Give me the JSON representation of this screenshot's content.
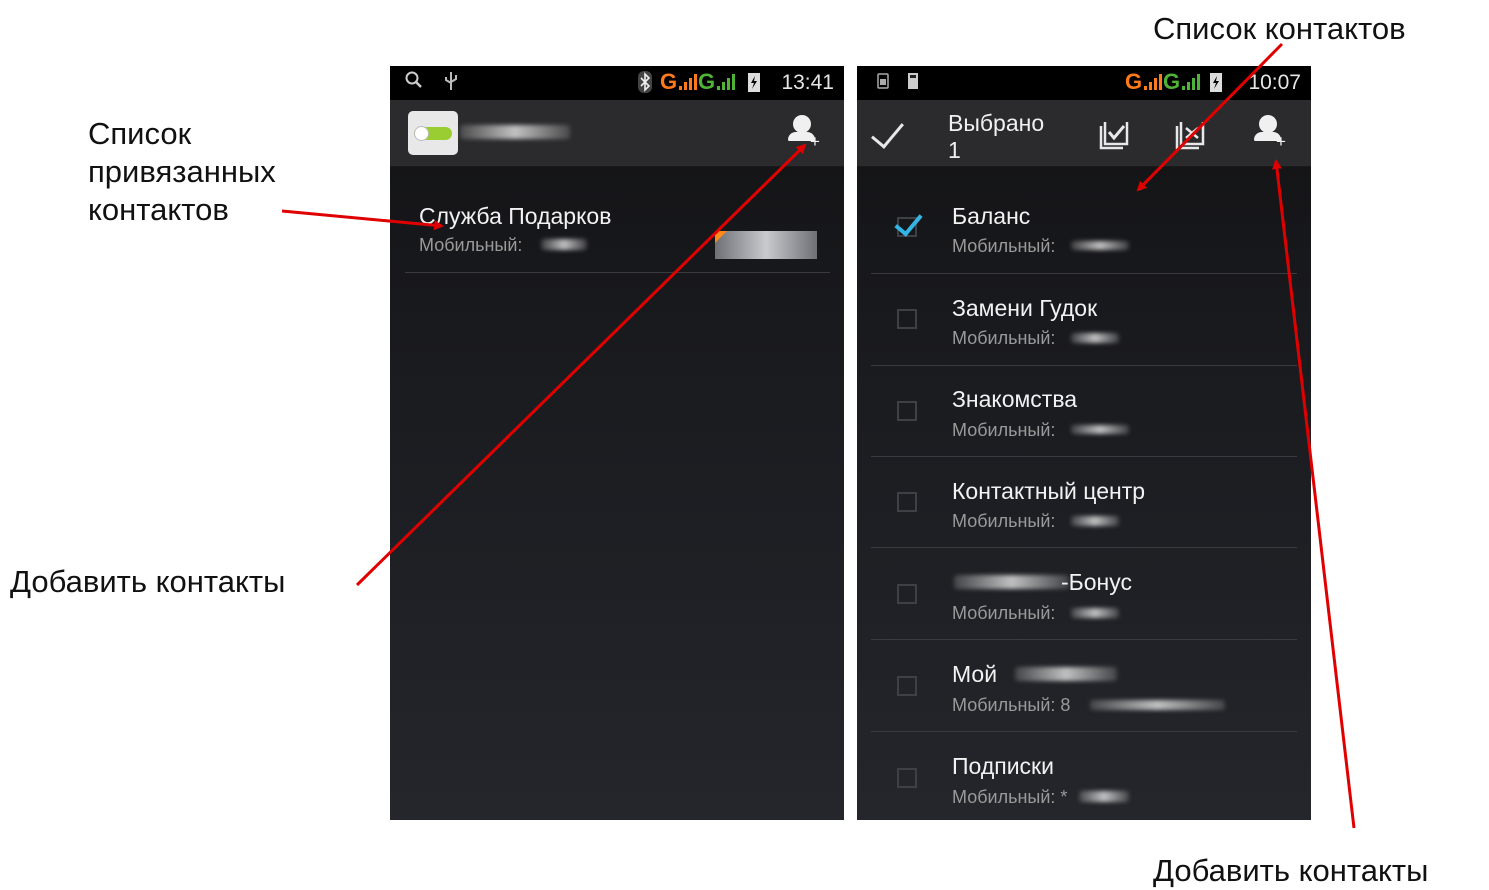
{
  "annotations": {
    "top_right": "Список контактов",
    "left_top": [
      "Список",
      "привязанных",
      "контактов"
    ],
    "left_bottom": "Добавить контакты",
    "bottom_right": "Добавить контакты"
  },
  "left_screen": {
    "status": {
      "time": "13:41",
      "network1": "G",
      "network2": "G"
    },
    "contacts": [
      {
        "name": "Служба Подарков",
        "subtitle": "Мобильный:"
      }
    ]
  },
  "right_screen": {
    "status": {
      "time": "10:07",
      "network1": "G",
      "network2": "G"
    },
    "selection": {
      "label": "Выбрано",
      "count": "1"
    },
    "contacts": [
      {
        "name": "Баланс",
        "subtitle": "Мобильный:",
        "checked": true
      },
      {
        "name": "Замени Гудок",
        "subtitle": "Мобильный:",
        "checked": false
      },
      {
        "name": "Знакомства",
        "subtitle": "Мобильный:",
        "checked": false
      },
      {
        "name": "Контактный центр",
        "subtitle": "Мобильный:",
        "checked": false
      },
      {
        "name": "-Бонус",
        "subtitle": "Мобильный:",
        "checked": false
      },
      {
        "name": "Мой",
        "subtitle": "Мобильный: 8",
        "checked": false
      },
      {
        "name": "Подписки",
        "subtitle": "Мобильный: *",
        "checked": false
      }
    ]
  },
  "colors": {
    "arrow": "#e00000",
    "check": "#33b5e5",
    "accent_orange": "#ff7a1a",
    "signal_green": "#4fb337"
  },
  "icons": [
    "search-icon",
    "usb-icon",
    "bluetooth-icon",
    "battery-icon",
    "person-add-icon",
    "check-icon",
    "select-all-icon",
    "deselect-all-icon"
  ]
}
